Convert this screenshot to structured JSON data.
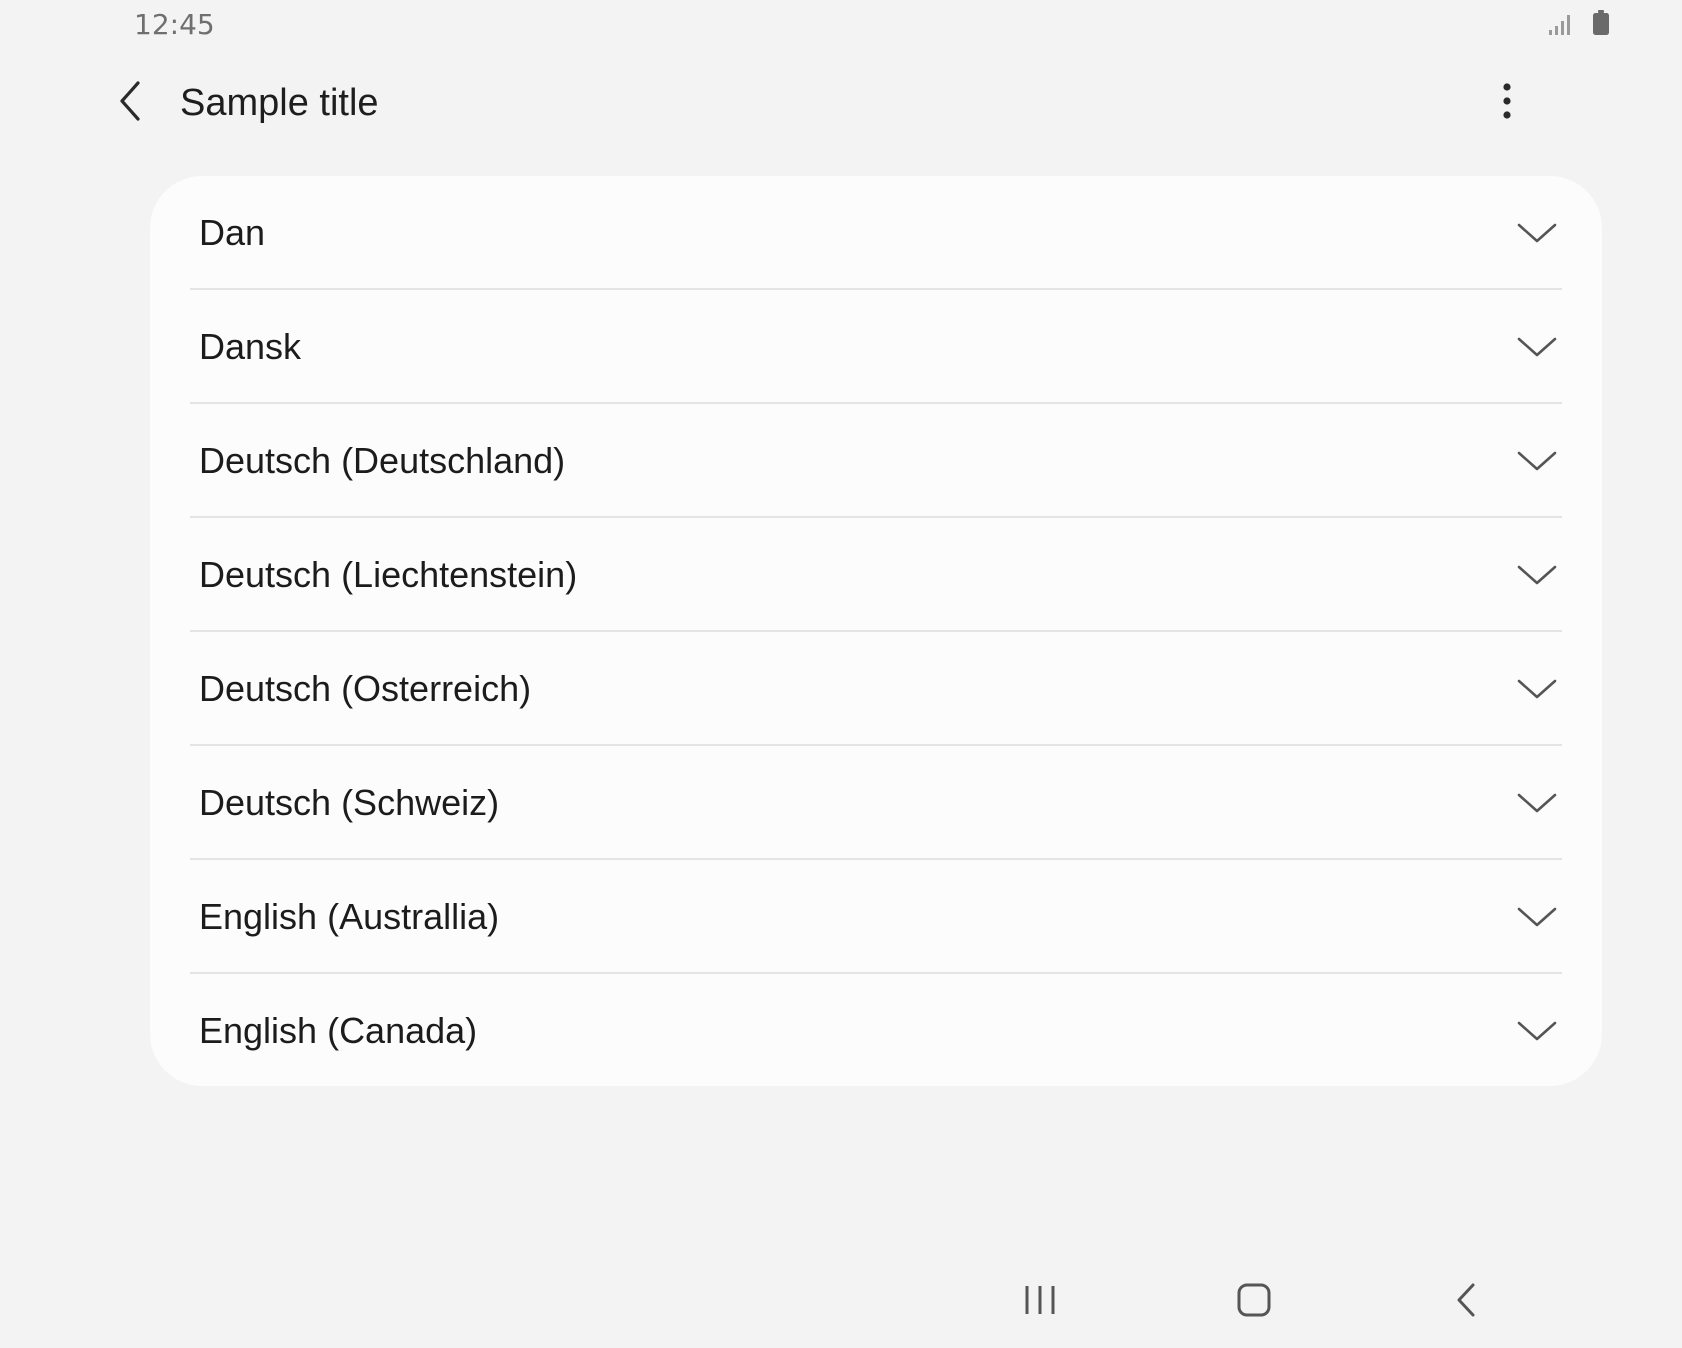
{
  "status_bar": {
    "time": "12:45",
    "icons": [
      "signal-icon",
      "battery-icon"
    ]
  },
  "app_bar": {
    "title": "Sample title",
    "back_icon": "chevron-left-icon",
    "menu_icon": "more-vertical-icon"
  },
  "list": {
    "items": [
      {
        "label": "Dan"
      },
      {
        "label": "Dansk"
      },
      {
        "label": "Deutsch (Deutschland)"
      },
      {
        "label": "Deutsch (Liechtenstein)"
      },
      {
        "label": "Deutsch (Osterreich)"
      },
      {
        "label": "Deutsch (Schweiz)"
      },
      {
        "label": "English (Australlia)"
      },
      {
        "label": "English (Canada)"
      }
    ],
    "item_icon": "chevron-down-icon"
  },
  "nav_bar": {
    "buttons": [
      "recents-icon",
      "home-icon",
      "back-icon"
    ]
  },
  "colors": {
    "background": "#f3f3f3",
    "card": "#fcfcfc",
    "divider": "#e4e4e4",
    "text": "#1c1c1c",
    "icon": "#555555"
  }
}
